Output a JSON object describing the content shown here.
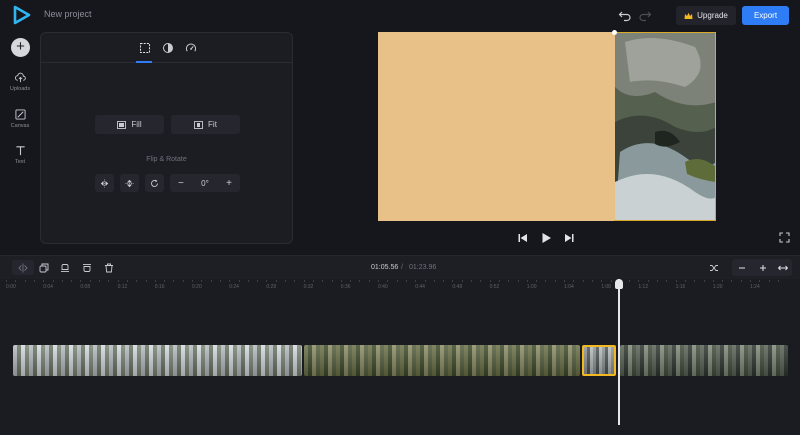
{
  "header": {
    "project_name": "New project",
    "upgrade_label": "Upgrade",
    "export_label": "Export"
  },
  "rail": {
    "items": [
      {
        "label": "Uploads",
        "icon": "upload-cloud-icon"
      },
      {
        "label": "Canvas",
        "icon": "canvas-icon"
      },
      {
        "label": "Text",
        "icon": "text-icon"
      }
    ]
  },
  "panel": {
    "tabs": [
      {
        "icon": "crop-frame-icon",
        "active": true
      },
      {
        "icon": "contrast-icon",
        "active": false
      },
      {
        "icon": "speed-gauge-icon",
        "active": false
      }
    ],
    "fill_label": "Fill",
    "fit_label": "Fit",
    "flip_rotate_label": "Flip & Rotate",
    "rotation_value": "0°",
    "rotation_minus": "−",
    "rotation_plus": "+"
  },
  "playback": {
    "current_time": "01:05.56",
    "separator": "/",
    "total_time": "01:23.96"
  },
  "timeline": {
    "ticks": [
      "0:00",
      "0:04",
      "0:08",
      "0:12",
      "0:16",
      "0:20",
      "0:24",
      "0:28",
      "0:32",
      "0:36",
      "0:40",
      "0:44",
      "0:48",
      "0:52",
      "1:00",
      "1:04",
      "1:08",
      "1:12",
      "1:16",
      "1:20",
      "1:24"
    ]
  },
  "colors": {
    "accent": "#2f7df6",
    "selection": "#f2b821",
    "canvas_background": "#e7c187"
  }
}
